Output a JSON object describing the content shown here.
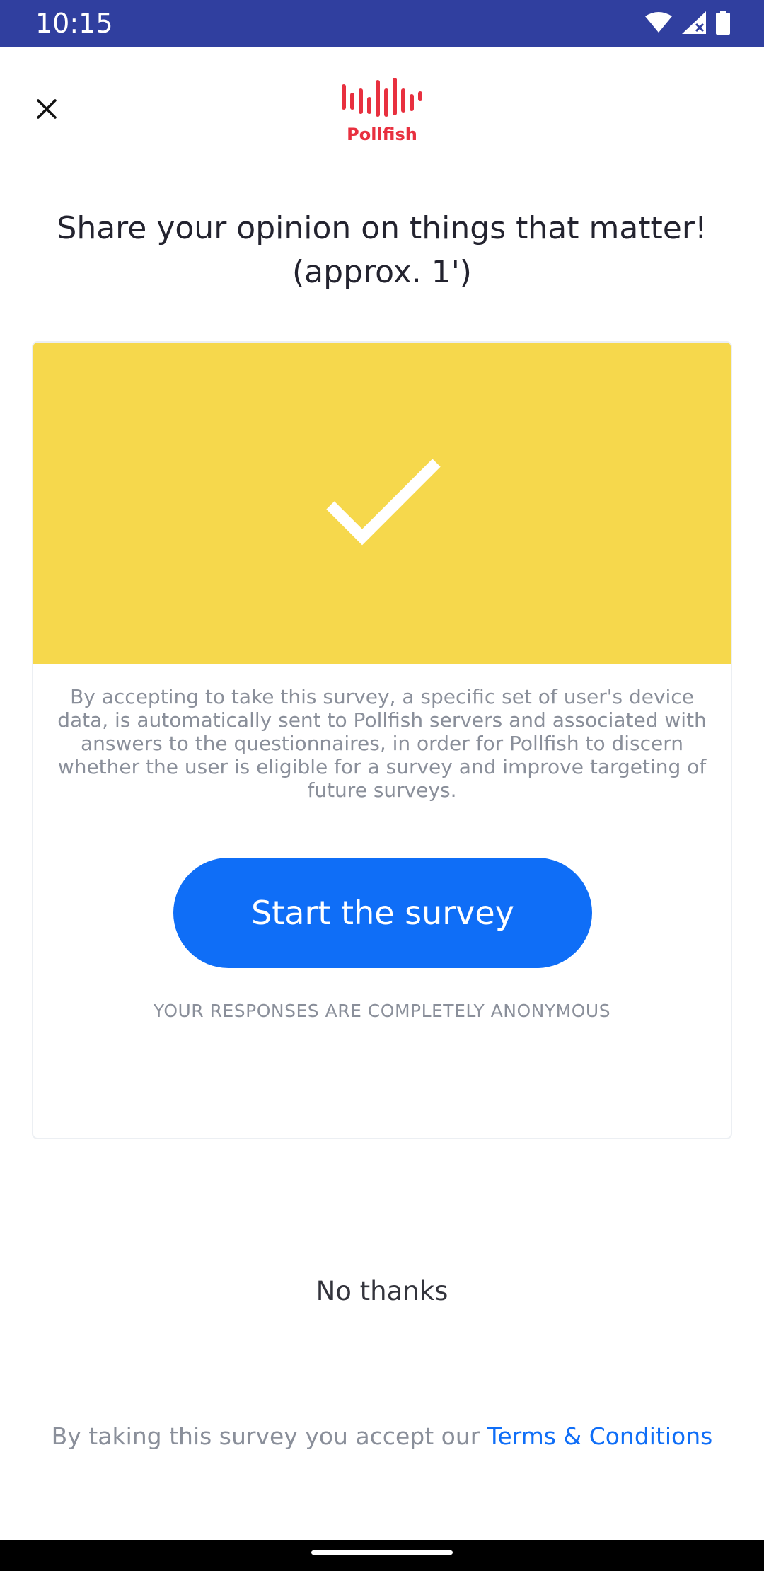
{
  "status_bar": {
    "time": "10:15",
    "icons": [
      "wifi-icon",
      "signal-icon",
      "battery-icon"
    ]
  },
  "header": {
    "close_icon": "close-icon",
    "logo_text": "Pollfish"
  },
  "headline": "Share your opinion on things that matter! (approx. 1')",
  "card": {
    "banner_color": "#f6d84c",
    "banner_icon": "checkmark-icon",
    "disclaimer": "By accepting to take this survey, a specific set of user's device data, is automatically sent to Pollfish servers and associated with answers to the questionnaires, in order for Pollfish to discern whether the user is eligible for a survey and improve targeting of future surveys.",
    "start_button_label": "Start the survey",
    "anonymous_note": "YOUR RESPONSES ARE COMPLETELY ANONYMOUS"
  },
  "no_thanks_label": "No thanks",
  "footer": {
    "terms_prefix": "By taking this survey you accept our ",
    "terms_link": "Terms & Conditions"
  },
  "colors": {
    "status_bar": "#303f9f",
    "brand_red": "#e8303f",
    "accent_blue": "#0f6ef7",
    "banner_yellow": "#f6d84c"
  }
}
